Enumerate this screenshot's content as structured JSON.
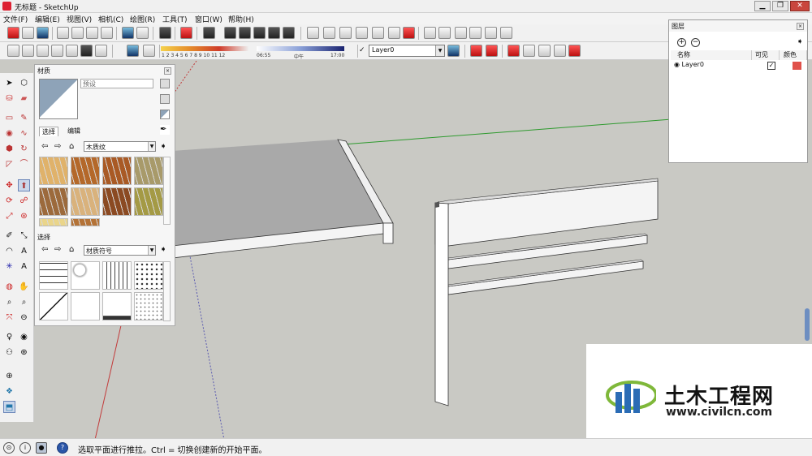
{
  "window": {
    "title": "无标题 - SketchUp",
    "minimize": "▁",
    "restore": "❐",
    "close": "✕"
  },
  "menu": [
    "文件(F)",
    "编辑(E)",
    "视图(V)",
    "相机(C)",
    "绘图(R)",
    "工具(T)",
    "窗口(W)",
    "帮助(H)"
  ],
  "shadow": {
    "months": "1 2 3 4 5 6 7 8 9 10 11 12",
    "time_start": "06:55",
    "time_mid": "中午",
    "time_end": "17:00"
  },
  "layer_toolbar": {
    "check": "✓",
    "current_layer": "Layer0"
  },
  "materials_panel": {
    "title": "材质",
    "preset_placeholder": "预设",
    "tab_select": "选择",
    "tab_edit": "编辑",
    "library_top": "木质纹",
    "section2_label": "选择",
    "library_bottom": "材质符号",
    "wood_tiles": [
      "#e0b26a",
      "#b4682a",
      "#a95a25",
      "#a89a6a",
      "#9c6a3c",
      "#d9b27c",
      "#8b4a22",
      "#a49a45",
      "#ead58a",
      "#b47236",
      "#c9a27a",
      "#d6c59e"
    ],
    "pattern_tiles": [
      "brick",
      "stone",
      "lines",
      "dots",
      "slash",
      "blank",
      "hline",
      "speckle"
    ]
  },
  "layer_panel": {
    "title": "图层",
    "add": "+",
    "remove": "−",
    "col_name": "名称",
    "col_visible": "可见",
    "col_color": "颜色",
    "row_name": "Layer0",
    "row_visible": "✓",
    "row_color": "#e0514a"
  },
  "status": {
    "text": "选取平面进行推拉。Ctrl = 切换创建新的开始平面。",
    "help": "?",
    "info": "i"
  },
  "watermark": {
    "title": "土木工程网",
    "url": "www.civilcn.com"
  },
  "colors": {
    "accent_blue": "#2b6cb5",
    "accent_green": "#7fb83a"
  }
}
